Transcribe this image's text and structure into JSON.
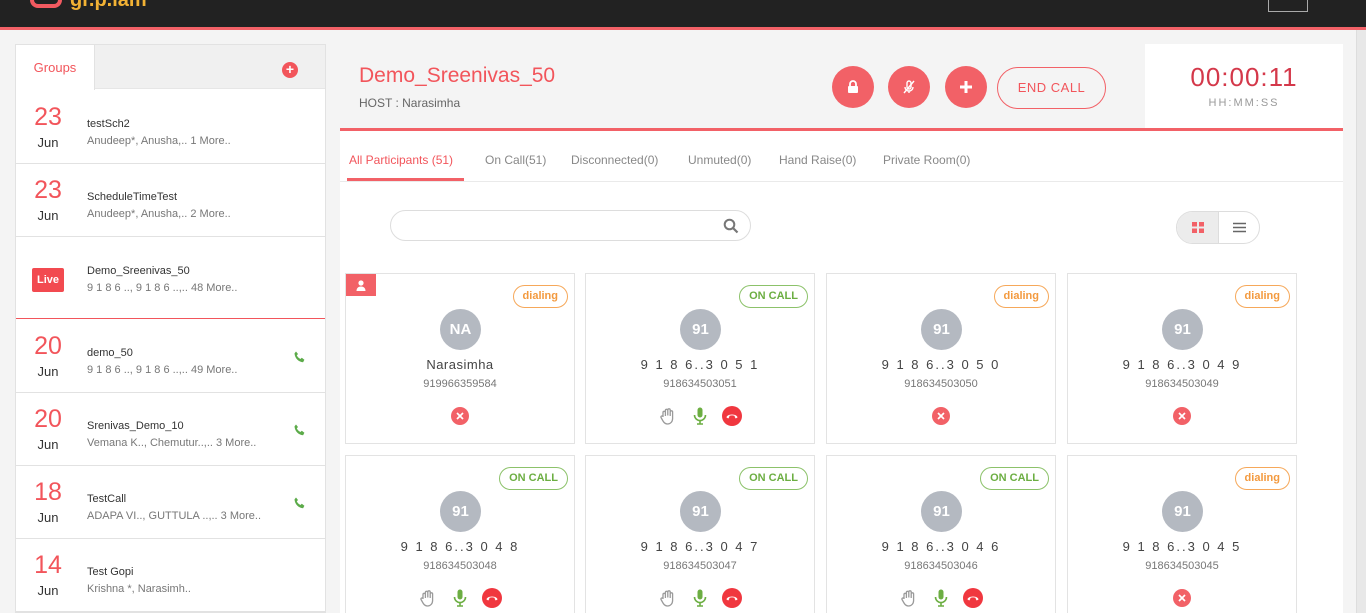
{
  "app": {
    "logo_text": "gr.p.iam"
  },
  "sidebar": {
    "tab_label": "Groups",
    "add_symbol": "+",
    "items": [
      {
        "day": "23",
        "month": "Jun",
        "title": "testSch2",
        "sub": "Anudeep*, Anusha,.. 1 More..",
        "live": false,
        "phone": false
      },
      {
        "day": "23",
        "month": "Jun",
        "title": "ScheduleTimeTest",
        "sub": "Anudeep*, Anusha,.. 2 More..",
        "live": false,
        "phone": false
      },
      {
        "live_label": "Live",
        "title": "Demo_Sreenivas_50",
        "sub": "9 1 8 6 .., 9 1 8 6 ..,.. 48 More..",
        "live": true,
        "phone": false
      },
      {
        "day": "20",
        "month": "Jun",
        "title": "demo_50",
        "sub": "9 1 8 6 .., 9 1 8 6 ..,.. 49 More..",
        "live": false,
        "phone": true
      },
      {
        "day": "20",
        "month": "Jun",
        "title": "Srenivas_Demo_10",
        "sub": "Vemana K.., Chemutur..,.. 3 More..",
        "live": false,
        "phone": true
      },
      {
        "day": "18",
        "month": "Jun",
        "title": "TestCall",
        "sub": "ADAPA VI.., GUTTULA ..,.. 3 More..",
        "live": false,
        "phone": true
      },
      {
        "day": "14",
        "month": "Jun",
        "title": "Test Gopi",
        "sub": "Krishna *, Narasimh..",
        "live": false,
        "phone": false
      }
    ]
  },
  "meeting": {
    "title": "Demo_Sreenivas_50",
    "host": "HOST : Narasimha",
    "end_call_label": "END CALL",
    "timer": "00:00:11",
    "timer_label": "HH:MM:SS"
  },
  "tabs": [
    {
      "label": "All Participants (51)",
      "active": true
    },
    {
      "label": "On Call(51)",
      "active": false
    },
    {
      "label": "Disconnected(0)",
      "active": false
    },
    {
      "label": "Unmuted(0)",
      "active": false
    },
    {
      "label": "Hand Raise(0)",
      "active": false
    },
    {
      "label": "Private Room(0)",
      "active": false
    }
  ],
  "search": {
    "placeholder": ""
  },
  "participants": [
    {
      "initials": "NA",
      "name": "Narasimha",
      "phone": "919966359584",
      "status": "dialing",
      "host": true,
      "controls": false
    },
    {
      "initials": "91",
      "name": "9 1 8 6..3 0 5 1",
      "phone": "918634503051",
      "status": "ON CALL",
      "host": false,
      "controls": true
    },
    {
      "initials": "91",
      "name": "9 1 8 6..3 0 5 0",
      "phone": "918634503050",
      "status": "dialing",
      "host": false,
      "controls": false
    },
    {
      "initials": "91",
      "name": "9 1 8 6..3 0 4 9",
      "phone": "918634503049",
      "status": "dialing",
      "host": false,
      "controls": false
    },
    {
      "initials": "91",
      "name": "9 1 8 6..3 0 4 8",
      "phone": "918634503048",
      "status": "ON CALL",
      "host": false,
      "controls": true
    },
    {
      "initials": "91",
      "name": "9 1 8 6..3 0 4 7",
      "phone": "918634503047",
      "status": "ON CALL",
      "host": false,
      "controls": true
    },
    {
      "initials": "91",
      "name": "9 1 8 6..3 0 4 6",
      "phone": "918634503046",
      "status": "ON CALL",
      "host": false,
      "controls": true
    },
    {
      "initials": "91",
      "name": "9 1 8 6..3 0 4 5",
      "phone": "918634503045",
      "status": "dialing",
      "host": false,
      "controls": false
    }
  ],
  "colors": {
    "accent": "#f26167",
    "dialing": "#f39a3f",
    "on_call": "#6cae42",
    "avatar": "#b4b9c1"
  }
}
